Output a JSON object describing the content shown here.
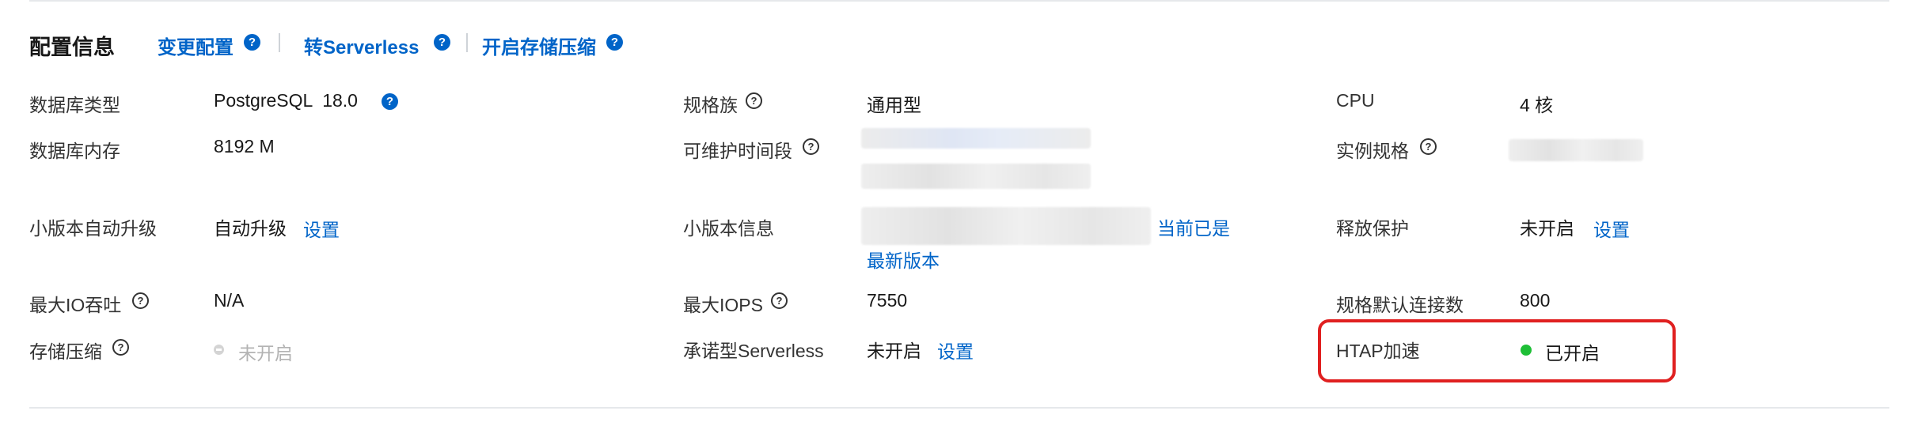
{
  "header": {
    "title": "配置信息",
    "links": [
      {
        "label": "变更配置"
      },
      {
        "label": "转Serverless"
      },
      {
        "label": "开启存储压缩"
      }
    ]
  },
  "fields": {
    "db_type": {
      "label": "数据库类型",
      "value": "PostgreSQL  18.0"
    },
    "db_memory": {
      "label": "数据库内存",
      "value": "8192 M"
    },
    "minor_auto_upgrade": {
      "label": "小版本自动升级",
      "value": "自动升级",
      "action": "设置"
    },
    "max_io": {
      "label": "最大IO吞吐",
      "value": "N/A"
    },
    "storage_compression": {
      "label": "存储压缩",
      "value": "未开启"
    },
    "spec_family": {
      "label": "规格族",
      "value": "通用型"
    },
    "maintenance_window": {
      "label": "可维护时间段"
    },
    "minor_version_info": {
      "label": "小版本信息",
      "link_line1": "当前已是",
      "link_line2": "最新版本"
    },
    "max_iops": {
      "label": "最大IOPS",
      "value": "7550"
    },
    "committed_serverless": {
      "label": "承诺型Serverless",
      "value": "未开启",
      "action": "设置"
    },
    "cpu": {
      "label": "CPU",
      "value": "4 核"
    },
    "instance_spec": {
      "label": "实例规格"
    },
    "release_protection": {
      "label": "释放保护",
      "value": "未开启",
      "action": "设置"
    },
    "default_connections": {
      "label": "规格默认连接数",
      "value": "800"
    },
    "htap": {
      "label": "HTAP加速",
      "value": "已开启"
    }
  },
  "colors": {
    "link": "#0064c8",
    "status_on": "#1ebf36",
    "highlight": "#e02020"
  }
}
